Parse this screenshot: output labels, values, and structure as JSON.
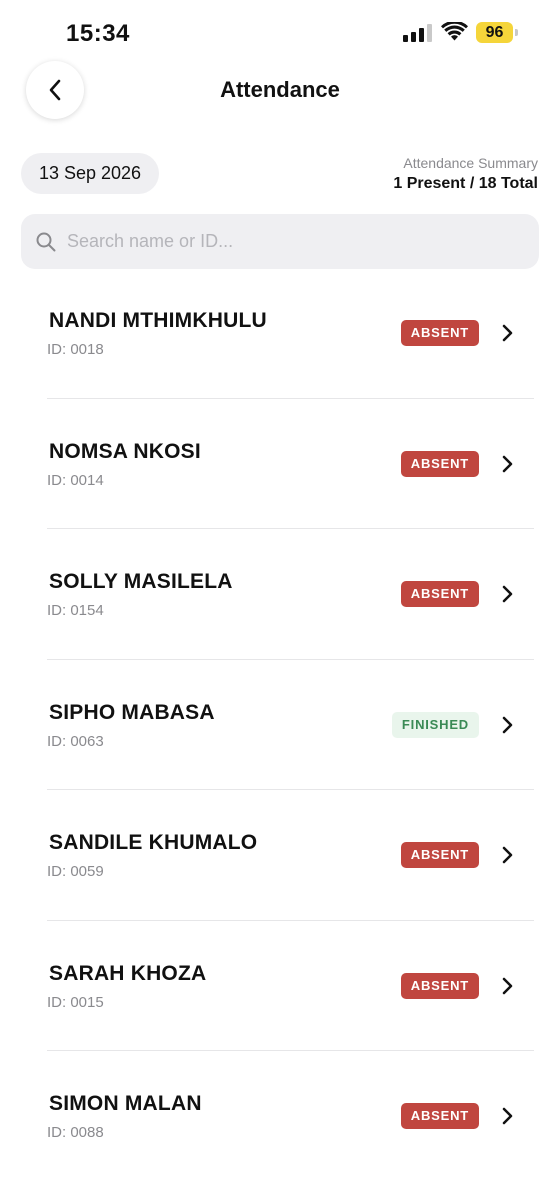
{
  "status_bar": {
    "time": "15:34",
    "battery": "96"
  },
  "header": {
    "title": "Attendance",
    "back_icon": "chevron-left-icon"
  },
  "date": "13 Sep 2026",
  "summary": {
    "label": "Attendance Summary",
    "value": "1 Present / 18 Total"
  },
  "search": {
    "placeholder": "Search name or ID..."
  },
  "colors": {
    "absent": "#c0463f",
    "finished_bg": "#e9f5ec",
    "finished_text": "#3a8a55",
    "battery": "#f5d53a"
  },
  "attendees": [
    {
      "name": "NANDI MTHIMKHULU",
      "id": "ID: 0018",
      "status": "ABSENT"
    },
    {
      "name": "NOMSA NKOSI",
      "id": "ID: 0014",
      "status": "ABSENT"
    },
    {
      "name": "SOLLY MASILELA",
      "id": "ID: 0154",
      "status": "ABSENT"
    },
    {
      "name": "SIPHO MABASA",
      "id": "ID: 0063",
      "status": "FINISHED"
    },
    {
      "name": "SANDILE KHUMALO",
      "id": "ID: 0059",
      "status": "ABSENT"
    },
    {
      "name": "SARAH KHOZA",
      "id": "ID: 0015",
      "status": "ABSENT"
    },
    {
      "name": "SIMON MALAN",
      "id": "ID: 0088",
      "status": "ABSENT"
    }
  ]
}
